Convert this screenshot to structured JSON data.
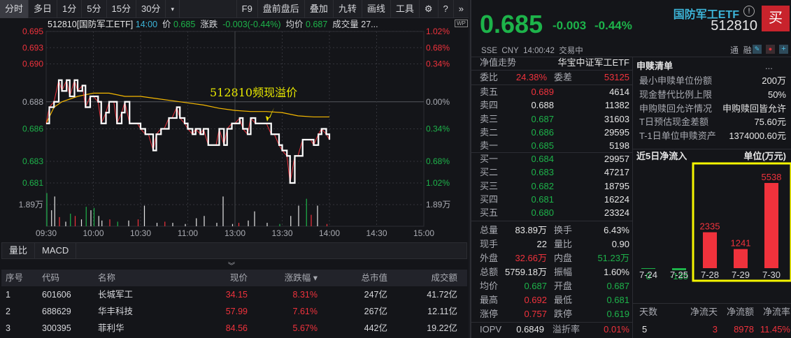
{
  "toolbar": {
    "tabs": [
      "分时",
      "多日",
      "1分",
      "5分",
      "15分",
      "30分"
    ],
    "more": "▾",
    "right": [
      "F9",
      "盘前盘后",
      "叠加",
      "九转",
      "画线",
      "工具"
    ],
    "icons": [
      "⚙",
      "?",
      "»"
    ]
  },
  "chart_header": {
    "code_name": "512810[国防军工ETF]",
    "time": "14:00",
    "price_label": "价",
    "price": "0.685",
    "change_label": "涨跌",
    "change": "-0.003(-0.44%)",
    "avg_label": "均价",
    "avg": "0.687",
    "vol_label": "成交量",
    "vol": "27...",
    "wp": "WP"
  },
  "annotation": "512810频现溢价",
  "chart_data": {
    "type": "line",
    "title": "512810[国防军工ETF] 分时",
    "y_ticks_left": [
      "0.695",
      "0.693",
      "0.690",
      "0.688",
      "0.686",
      "0.683",
      "0.681"
    ],
    "y_ticks_right": [
      "1.02%",
      "0.68%",
      "0.34%",
      "0.00%",
      "0.34%",
      "0.68%",
      "1.02%"
    ],
    "y_tick_values": [
      0.695,
      0.6935,
      0.692,
      0.6885,
      0.686,
      0.683,
      0.681
    ],
    "ylim": [
      0.681,
      0.695
    ],
    "prev_close": 0.688,
    "x_ticks": [
      "09:30",
      "10:00",
      "10:30",
      "11:00",
      "13:00",
      "13:30",
      "14:00",
      "14:30",
      "15:00"
    ],
    "x_minutes_range": [
      0,
      240
    ],
    "volume_tick": "1.89万",
    "series": [
      {
        "name": "价格",
        "color": "#ffffff",
        "minutes": [
          0,
          2,
          5,
          8,
          10,
          13,
          15,
          18,
          20,
          23,
          25,
          28,
          30,
          33,
          35,
          38,
          40,
          43,
          45,
          48,
          50,
          53,
          55,
          58,
          60,
          63,
          65,
          68,
          70,
          73,
          75,
          78,
          80,
          83,
          85,
          88,
          90,
          93,
          95,
          98,
          100,
          103,
          105,
          108,
          110,
          113,
          115,
          118,
          120,
          123,
          125,
          128,
          130,
          133,
          135,
          138,
          140,
          143,
          145,
          148,
          150,
          153,
          155,
          158,
          160,
          163,
          165,
          168,
          170,
          173,
          175,
          178,
          180
        ],
        "values": [
          0.6865,
          0.688,
          0.6885,
          0.6905,
          0.6895,
          0.6905,
          0.689,
          0.6905,
          0.6895,
          0.69,
          0.688,
          0.689,
          0.689,
          0.6885,
          0.6865,
          0.6875,
          0.6885,
          0.6885,
          0.6865,
          0.6875,
          0.6885,
          0.6865,
          0.6865,
          0.6865,
          0.686,
          0.6855,
          0.6855,
          0.684,
          0.6855,
          0.686,
          0.686,
          0.687,
          0.687,
          0.688,
          0.687,
          0.6865,
          0.686,
          0.6855,
          0.686,
          0.6855,
          0.686,
          0.6845,
          0.6845,
          0.6845,
          0.686,
          0.6845,
          0.686,
          0.6865,
          0.6865,
          0.687,
          0.686,
          0.6855,
          0.687,
          0.6865,
          0.6865,
          0.6865,
          0.6865,
          0.6855,
          0.6855,
          0.6845,
          0.684,
          0.6835,
          0.681,
          0.6835,
          0.6835,
          0.685,
          0.685,
          0.685,
          0.6845,
          0.6855,
          0.686,
          0.6855,
          0.685
        ]
      },
      {
        "name": "均价",
        "color": "#f5b800",
        "minutes": [
          0,
          5,
          10,
          20,
          30,
          40,
          50,
          60,
          70,
          80,
          90,
          100,
          110,
          120,
          130,
          140,
          150,
          160,
          170,
          180
        ],
        "values": [
          0.6865,
          0.688,
          0.6885,
          0.689,
          0.6893,
          0.6893,
          0.689,
          0.689,
          0.6888,
          0.6886,
          0.6884,
          0.6882,
          0.6879,
          0.6877,
          0.6876,
          0.6876,
          0.6875,
          0.6872,
          0.6871,
          0.6871
        ]
      },
      {
        "name": "成交量(万)",
        "minutes": [
          0,
          3,
          5,
          8,
          12,
          15,
          18,
          22,
          25,
          28,
          30,
          33,
          35,
          40,
          45,
          52,
          58,
          62,
          70,
          75,
          80,
          88,
          95,
          100,
          108,
          112,
          118,
          122,
          128,
          132,
          140,
          148,
          155,
          160,
          165,
          168,
          172,
          178
        ],
        "values": [
          2.9,
          1.4,
          2.6,
          0.8,
          0.4,
          1.1,
          0.9,
          0.6,
          1.7,
          1.4,
          1.6,
          0.9,
          0.5,
          0.6,
          0.4,
          0.5,
          0.6,
          1.8,
          0.3,
          0.4,
          0.3,
          0.2,
          0.7,
          0.9,
          0.3,
          2.6,
          0.2,
          0.3,
          0.5,
          1.3,
          0.3,
          0.2,
          0.9,
          1.8,
          2.4,
          1.0,
          1.8,
          0.2
        ],
        "colors": [
          "g",
          "w",
          "w",
          "r",
          "w",
          "g",
          "r",
          "w",
          "g",
          "w",
          "g",
          "w",
          "w",
          "r",
          "g",
          "w",
          "r",
          "w",
          "w",
          "r",
          "w",
          "w",
          "w",
          "w",
          "w",
          "w",
          "w",
          "r",
          "w",
          "w",
          "w",
          "g",
          "w",
          "w",
          "g",
          "r",
          "w",
          "r"
        ]
      }
    ]
  },
  "subtabs": [
    "量比",
    "MACD"
  ],
  "table": {
    "headers": [
      "序号",
      "代码",
      "名称",
      "现价",
      "涨跌幅 ▾",
      "总市值",
      "成交额"
    ],
    "rows": [
      [
        "1",
        "601606",
        "长城军工",
        "34.15",
        "8.31%",
        "247亿",
        "41.72亿"
      ],
      [
        "2",
        "688629",
        "华丰科技",
        "57.99",
        "7.61%",
        "267亿",
        "12.11亿"
      ],
      [
        "3",
        "300395",
        "菲利华",
        "84.56",
        "5.67%",
        "442亿",
        "19.22亿"
      ]
    ]
  },
  "quote": {
    "price": "0.685",
    "change": "-0.003",
    "pct": "-0.44%",
    "name": "国防军工ETF",
    "code": "512810",
    "buy": "买",
    "info_icon": "!",
    "exchange": "SSE",
    "currency": "CNY",
    "time": "14:00:42",
    "status": "交易中",
    "tags": [
      "通",
      "融"
    ],
    "colors": {
      "up": "#f0323c",
      "down": "#1db34a",
      "accent": "#3cb4d8"
    }
  },
  "orderbook": {
    "nav_label": "净值走势",
    "fund_name": "华宝中证军工ETF",
    "wb_label": "委比",
    "wb": "24.38%",
    "wc_label": "委差",
    "wc": "53125",
    "asks": [
      [
        "卖五",
        "0.689",
        "4614"
      ],
      [
        "卖四",
        "0.688",
        "11382"
      ],
      [
        "卖三",
        "0.687",
        "31603"
      ],
      [
        "卖二",
        "0.686",
        "29595"
      ],
      [
        "卖一",
        "0.685",
        "5198"
      ]
    ],
    "bids": [
      [
        "买一",
        "0.684",
        "29957"
      ],
      [
        "买二",
        "0.683",
        "47217"
      ],
      [
        "买三",
        "0.682",
        "18795"
      ],
      [
        "买四",
        "0.681",
        "16224"
      ],
      [
        "买五",
        "0.680",
        "23324"
      ]
    ],
    "stats": [
      [
        "总量",
        "83.89万",
        "换手",
        "6.43%"
      ],
      [
        "现手",
        "22",
        "量比",
        "0.90"
      ],
      [
        "外盘",
        "32.66万",
        "内盘",
        "51.23万"
      ],
      [
        "总额",
        "5759.18万",
        "振幅",
        "1.60%"
      ],
      [
        "均价",
        "0.687",
        "开盘",
        "0.687"
      ],
      [
        "最高",
        "0.692",
        "最低",
        "0.681"
      ],
      [
        "涨停",
        "0.757",
        "跌停",
        "0.619"
      ]
    ],
    "iopv_label": "IOPV",
    "iopv": "0.6849",
    "premium_label": "溢折率",
    "premium": "0.01%"
  },
  "creation": {
    "title": "申赎清单",
    "more": "...",
    "rows": [
      [
        "最小申赎单位份额",
        "200万"
      ],
      [
        "现金替代比例上限",
        "50%"
      ],
      [
        "申购赎回允许情况",
        "申购赎回皆允许"
      ],
      [
        "T日预估现金差额",
        "75.60元"
      ],
      [
        "T-1日单位申赎资产",
        "1374000.60元"
      ]
    ]
  },
  "netflow": {
    "title": "近5日净流入",
    "unit": "单位(万元)",
    "dates": [
      "7-24",
      "7-25",
      "7-28",
      "7-29",
      "7-30"
    ],
    "values": [
      0,
      -135,
      2335,
      1241,
      5538
    ],
    "labels": [
      "0",
      "-135",
      "2335",
      "1241",
      "5538"
    ],
    "summary_headers": [
      "天数",
      "净流天",
      "净流额",
      "净流率"
    ],
    "summary_values": [
      "5",
      "3",
      "8978",
      "11.45%"
    ]
  }
}
